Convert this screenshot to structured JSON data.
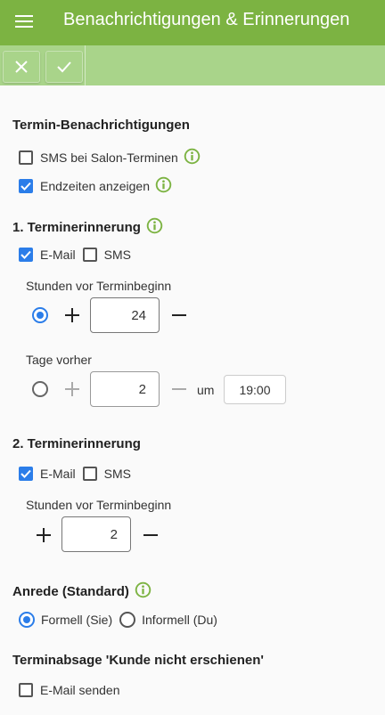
{
  "appbar": {
    "title": "Benachrichtigungen & Erinnerungen"
  },
  "colors": {
    "appbar": "#7cb342",
    "toolbar": "#a9d48a",
    "accent": "#2b7de9",
    "info": "#7cb342"
  },
  "termin_benachrichtigungen": {
    "title": "Termin-Benachrichtigungen",
    "sms_label": "SMS bei Salon-Terminen",
    "sms_checked": false,
    "endzeiten_label": "Endzeiten anzeigen",
    "endzeiten_checked": true
  },
  "erinnerung1": {
    "title": "1. Terminerinnerung",
    "email_label": "E-Mail",
    "email_checked": true,
    "sms_label": "SMS",
    "sms_checked": false,
    "hours_label": "Stunden vor Terminbeginn",
    "hours_value": "24",
    "hours_selected": true,
    "days_label": "Tage vorher",
    "days_value": "2",
    "days_selected": false,
    "um_label": "um",
    "time_value": "19:00"
  },
  "erinnerung2": {
    "title": "2. Terminerinnerung",
    "email_label": "E-Mail",
    "email_checked": true,
    "sms_label": "SMS",
    "sms_checked": false,
    "hours_label": "Stunden vor Terminbeginn",
    "hours_value": "2"
  },
  "anrede": {
    "title": "Anrede (Standard)",
    "formell_label": "Formell (Sie)",
    "formell_selected": true,
    "informell_label": "Informell (Du)",
    "informell_selected": false
  },
  "absage": {
    "title": "Terminabsage 'Kunde nicht erschienen'",
    "email_label": "E-Mail senden",
    "email_checked": false
  }
}
